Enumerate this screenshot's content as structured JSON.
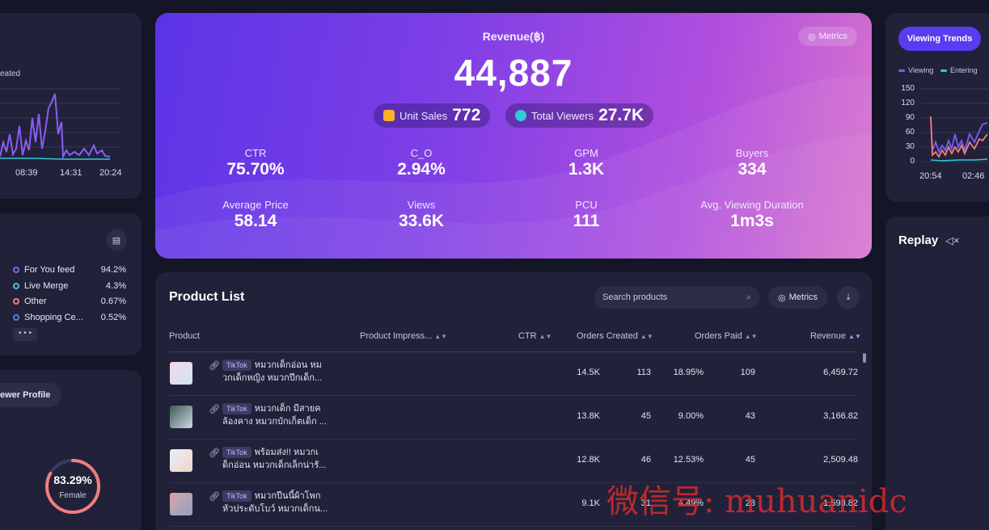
{
  "left": {
    "chart_legend": "eated",
    "times": [
      "08:39",
      "14:31",
      "20:24"
    ],
    "sources": [
      {
        "label": "For You feed",
        "pct": "94.2%",
        "color": "#8b5cf6"
      },
      {
        "label": "Live Merge",
        "pct": "4.3%",
        "color": "#3cc4cf"
      },
      {
        "label": "Other",
        "pct": "0.67%",
        "color": "#f07e7e"
      },
      {
        "label": "Shopping Ce...",
        "pct": "0.52%",
        "color": "#4b7cf3"
      }
    ],
    "more_label": "• • •",
    "viewer_profile_label": "ewer Profile",
    "female_pct": "83.29%",
    "female_label": "Female",
    "female_ratio": 0.8329
  },
  "hero": {
    "title": "Revenue(฿)",
    "value": "44,887",
    "metrics_label": "Metrics",
    "unit_sales_label": "Unit Sales",
    "unit_sales_value": "772",
    "total_viewers_label": "Total Viewers",
    "total_viewers_value": "27.7K",
    "kpis": [
      {
        "label": "CTR",
        "value": "75.70%"
      },
      {
        "label": "C_O",
        "value": "2.94%"
      },
      {
        "label": "GPM",
        "value": "1.3K"
      },
      {
        "label": "Buyers",
        "value": "334"
      },
      {
        "label": "Average Price",
        "value": "58.14"
      },
      {
        "label": "Views",
        "value": "33.6K"
      },
      {
        "label": "PCU",
        "value": "111"
      },
      {
        "label": "Avg. Viewing Duration",
        "value": "1m3s"
      }
    ]
  },
  "right": {
    "tab_label": "Viewing Trends",
    "legend_viewing": "Viewing",
    "legend_entering": "Entering",
    "yticks": [
      "150",
      "120",
      "90",
      "60",
      "30",
      "0"
    ],
    "times": [
      "20:54",
      "02:46"
    ],
    "replay_label": "Replay",
    "colors": {
      "viewing": "#7c5cf7",
      "entering": "#35c8d8"
    }
  },
  "products": {
    "title": "Product List",
    "search_placeholder": "Search products",
    "metrics_label": "Metrics",
    "columns": [
      "Product",
      "Product Impress...",
      "CTR",
      "Orders Created",
      "Orders Paid",
      "Revenue"
    ],
    "rows": [
      {
        "tag": "TikTok",
        "line1": "หมวกเด็กอ่อน หม",
        "line2": "วกเด็กหญิง หมวกปีกเด็ก...",
        "impressions": "14.5K",
        "ctr": "18.95%",
        "orders_created": "113",
        "orders_paid": "109",
        "revenue": "6,459.72"
      },
      {
        "tag": "TikTok",
        "line1": "หมวกเด็ก มีสายค",
        "line2": "ล้องคาง หมวกบักเก็ตเด็ก ...",
        "impressions": "13.8K",
        "ctr": "9.00%",
        "orders_created": "45",
        "orders_paid": "43",
        "revenue": "3,166.82"
      },
      {
        "tag": "TikTok",
        "line1": "พร้อมส่ง!! หมวกเ",
        "line2": "ด็กอ่อน หมวกเด็กเล็กน่ารั...",
        "impressions": "12.8K",
        "ctr": "12.53%",
        "orders_created": "46",
        "orders_paid": "45",
        "revenue": "2,509.48"
      },
      {
        "tag": "TikTok",
        "line1": "หมวกปีนนี้ผ้าโพก",
        "line2": "หัวประดับโบว์ หมวกเด็กน...",
        "impressions": "9.1K",
        "ctr": "4.49%",
        "orders_created": "31",
        "orders_paid": "28",
        "revenue": "1,593.82"
      }
    ]
  },
  "watermark": "微信号: muhuanidc"
}
